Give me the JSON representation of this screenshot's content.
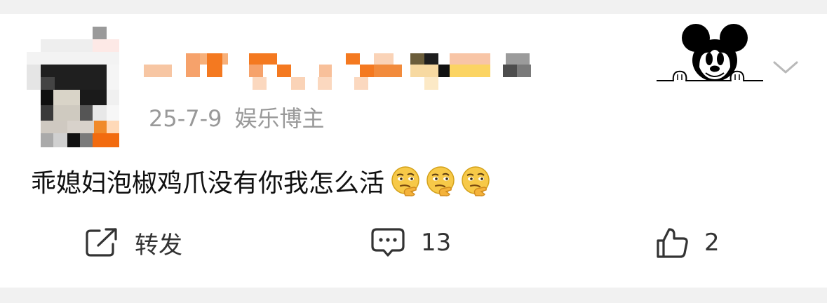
{
  "post": {
    "date": "25-7-9",
    "author_tag": "娱乐博主",
    "text": "乖媳妇泡椒鸡爪没有你我怎么活",
    "emoji_count": 3,
    "emoji_name": "thinking-face"
  },
  "actions": {
    "repost_label": "转发",
    "comment_count": "13",
    "like_count": "2"
  },
  "icons": [
    "mickey-mouse-icon",
    "chevron-down-icon",
    "repost-icon",
    "comment-icon",
    "thumbs-up-icon",
    "thinking-emoji-icon"
  ],
  "colors": {
    "meta_gray": "#999999",
    "text": "#111111",
    "divider": "#f1f1f1",
    "emoji_yellow": "#f7c948"
  }
}
